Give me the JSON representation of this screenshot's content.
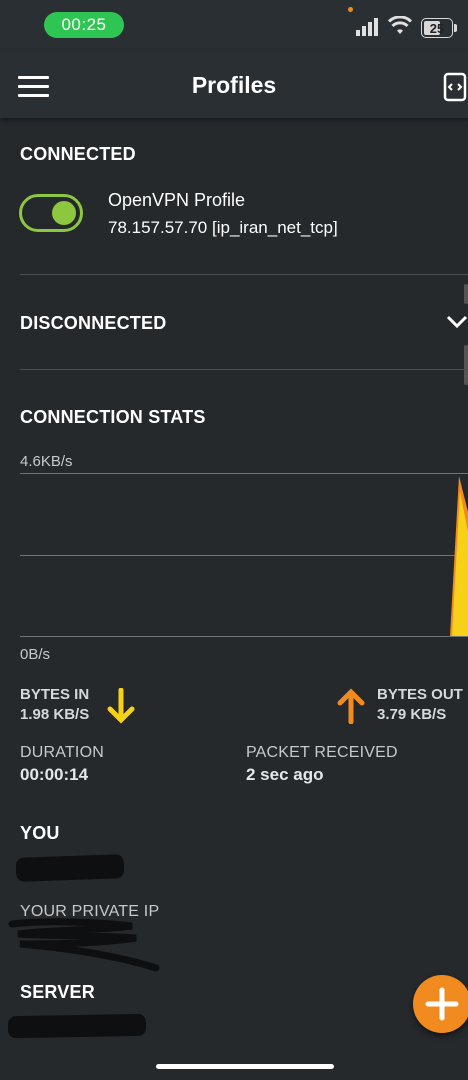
{
  "status_bar": {
    "time": "00:25",
    "battery": "25"
  },
  "app_bar": {
    "title": "Profiles"
  },
  "connected": {
    "heading": "CONNECTED",
    "profile_name": "OpenVPN Profile",
    "profile_detail": "78.157.57.70 [ip_iran_net_tcp]",
    "toggle_on": true
  },
  "disconnected": {
    "heading": "DISCONNECTED"
  },
  "stats": {
    "heading": "CONNECTION STATS",
    "graph_max": "4.6KB/s",
    "graph_min": "0B/s",
    "bytes_in_label": "BYTES IN",
    "bytes_in_value": "1.98 KB/S",
    "bytes_out_label": "BYTES OUT",
    "bytes_out_value": "3.79 KB/S",
    "duration_label": "DURATION",
    "duration_value": "00:00:14",
    "packet_label": "PACKET RECEIVED",
    "packet_value": "2 sec ago"
  },
  "you": {
    "heading": "YOU",
    "private_ip_label": "YOUR PRIVATE IP"
  },
  "server": {
    "heading": "SERVER"
  },
  "colors": {
    "accent_green": "#8dc63f",
    "bytes_in": "#f7d117",
    "bytes_out": "#f28b1f",
    "background": "#25292c"
  },
  "icons": [
    "menu-icon",
    "import-profile-icon",
    "chevron-down-icon",
    "arrow-down-icon",
    "arrow-up-icon",
    "plus-icon"
  ]
}
